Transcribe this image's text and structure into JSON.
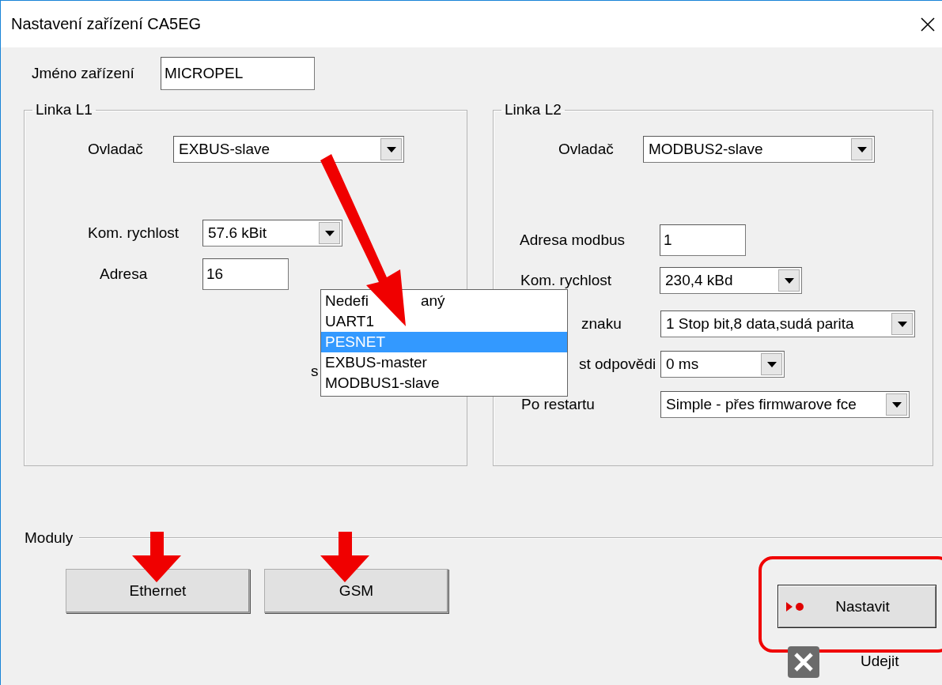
{
  "window": {
    "title": "Nastavení zařízení CA5EG"
  },
  "device_name": {
    "label": "Jméno zařízení",
    "value": "MICROPEL"
  },
  "groups": [
    {
      "title": "Linka L1",
      "fields": [
        {
          "kind": "combo",
          "label": "Ovladač",
          "value": "EXBUS-slave"
        },
        {
          "kind": "combo",
          "label": "Kom. rychlost",
          "value": "57.6 kBit"
        },
        {
          "kind": "input",
          "label": "Adresa",
          "value": "16"
        },
        {
          "kind": "label",
          "label": "s"
        }
      ]
    },
    {
      "title": "Linka L2",
      "fields": [
        {
          "kind": "combo",
          "label": "Ovladač",
          "value": "MODBUS2-slave"
        },
        {
          "kind": "input",
          "label": "Adresa modbus",
          "value": "1"
        },
        {
          "kind": "combo",
          "label": "Kom. rychlost",
          "value": "230,4 kBd"
        },
        {
          "kind": "combo",
          "label": "znaku",
          "value": "1 Stop bit,8 data,sudá parita"
        },
        {
          "kind": "combo",
          "label": "st odpovědi",
          "value": "0 ms"
        },
        {
          "kind": "combo",
          "label": "Po restartu",
          "value": "Simple - přes firmwarove fce"
        }
      ]
    }
  ],
  "dropdown_list": {
    "items": [
      {
        "parts": [
          "Nedefi",
          "aný"
        ],
        "selected": false
      },
      {
        "parts": [
          "UART1"
        ],
        "selected": false
      },
      {
        "parts": [
          "PESNET"
        ],
        "selected": true
      },
      {
        "parts": [
          "EXBUS-master"
        ],
        "selected": false
      },
      {
        "parts": [
          "MODBUS1-slave"
        ],
        "selected": false
      }
    ]
  },
  "modules": {
    "label": "Moduly",
    "buttons": [
      "Ethernet",
      "GSM"
    ]
  },
  "actions": [
    {
      "kind": "set",
      "label": "Nastavit"
    },
    {
      "kind": "exit",
      "label": "Udejit"
    }
  ]
}
